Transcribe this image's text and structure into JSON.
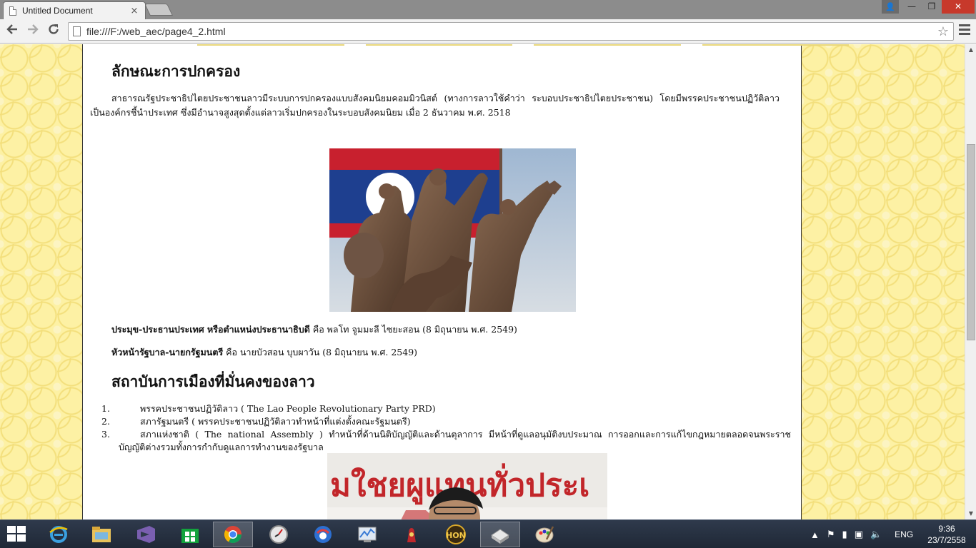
{
  "browser": {
    "tab_title": "Untitled Document",
    "tab_close": "×",
    "url": "file:///F:/web_aec/page4_2.html",
    "window_controls": {
      "user": "👤",
      "minimize": "—",
      "maximize": "❐",
      "close": "✕"
    }
  },
  "page": {
    "heading_governance": "ลักษณะการปกครอง",
    "paragraph_governance": "สาธารณรัฐประชาธิปไตยประชาชนลาวมีระบบการปกครองแบบสังคมนิยมคอมมิวนิสต์ (ทางการลาวใช้คำว่า ระบอบประชาธิปไตยประชาชน) โดยมีพรรคประชาชนปฏิวัติลาวเป็นองค์กรชี้นำประเทศ ซึ่งมีอำนาจสูงสุดตั้งแต่ลาวเริ่มปกครองในระบอบสังคมนิยม เมื่อ 2 ธันวาคม พ.ศ. 2518",
    "head_of_state_label": "ประมุข-ประธานประเทศ หรือตำแหน่งประธานาธิบดี",
    "head_of_state_value": "คือ พลโท จูมมะลี ไซยะสอน (8 มิถุนายน พ.ศ. 2549)",
    "head_of_gov_label": "หัวหน้ารัฐบาล-นายกรัฐมนตรี",
    "head_of_gov_value": "คือ นายบัวสอน บุบผาวัน (8 มิถุนายน พ.ศ. 2549)",
    "heading_institutions": "สถาบันการเมืองที่มั่นคงของลาว",
    "institutions": [
      {
        "num": "1.",
        "text": "พรรคประชาชนปฏิวัติลาว ( The Lao People Revolutionary Party PRD)"
      },
      {
        "num": "2.",
        "text": "สภารัฐมนตรี ( พรรคประชาชนปฏิวัติลาวทำหน้าที่แต่งตั้งคณะรัฐมนตรี)"
      },
      {
        "num": "3.",
        "text": "สภาแห่งชาติ ( The national Assembly ) ทำหน้าที่ด้านนิติบัญญัติและด้านตุลาการ มีหน้าที่ดูแลอนุมัติงบประมาณ การออกและการแก้ไขกฎหมายตลอดจนพระราชบัญญัติต่างรวมทั้งการกำกับดูแลการทำงานของรัฐบาล"
      }
    ],
    "banner_text": "มใชยผูแทนทั่วประเ"
  },
  "taskbar": {
    "language": "ENG",
    "time": "9:36",
    "date": "23/7/2558"
  }
}
